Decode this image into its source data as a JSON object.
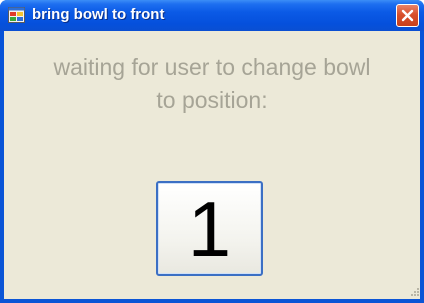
{
  "window": {
    "title": "bring bowl to front",
    "close_symbol": "close-icon"
  },
  "main": {
    "message_line1": "waiting for user to change bowl",
    "message_line2": "to position:",
    "position_value": "1"
  },
  "colors": {
    "title_bar": "#0a5fe0",
    "client_background": "#ece9d8",
    "message_text": "#a6a496",
    "close_button": "#d8502c",
    "button_border": "#3b6fc4"
  },
  "icons": {
    "app": "application-icon",
    "close": "close-icon",
    "resize": "resize-grip-icon"
  }
}
